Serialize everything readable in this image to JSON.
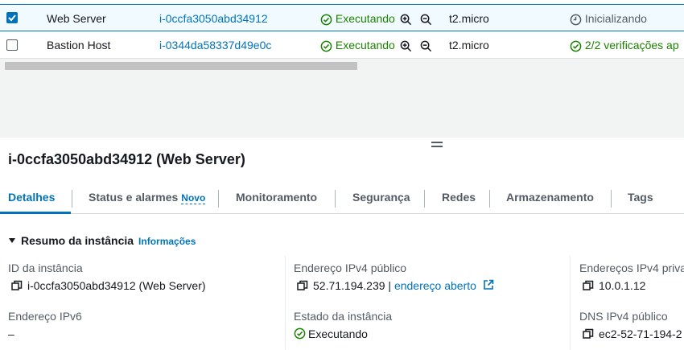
{
  "table": {
    "rows": [
      {
        "selected": true,
        "name": "Web Server",
        "instance_id": "i-0ccfa3050abd34912",
        "state": "Executando",
        "type": "t2.micro",
        "status_check": "Inicializando",
        "status_kind": "pending"
      },
      {
        "selected": false,
        "name": "Bastion Host",
        "instance_id": "i-0344da58337d49e0c",
        "state": "Executando",
        "type": "t2.micro",
        "status_check": "2/2 verificações ap",
        "status_kind": "ok"
      }
    ]
  },
  "details": {
    "title": "i-0ccfa3050abd34912 (Web Server)",
    "tabs": [
      {
        "label": "Detalhes",
        "active": true
      },
      {
        "label": "Status e alarmes",
        "badge": "Novo"
      },
      {
        "label": "Monitoramento"
      },
      {
        "label": "Segurança"
      },
      {
        "label": "Redes"
      },
      {
        "label": "Armazenamento"
      },
      {
        "label": "Tags"
      }
    ],
    "section": {
      "title": "Resumo da instância",
      "info_link": "Informações"
    },
    "fields": {
      "instance_id_label": "ID da instância",
      "instance_id_value": "i-0ccfa3050abd34912 (Web Server)",
      "public_ipv4_label": "Endereço IPv4 público",
      "public_ipv4_value": "52.71.194.239",
      "public_ipv4_sep": " | ",
      "public_ipv4_link": "endereço aberto",
      "private_ipv4_label": "Endereços IPv4 priva",
      "private_ipv4_value": "10.0.1.12",
      "ipv6_label": "Endereço IPv6",
      "ipv6_value": "–",
      "state_label": "Estado da instância",
      "state_value": "Executando",
      "public_dns_label": "DNS IPv4 público",
      "public_dns_value": "ec2-52-71-194-2"
    }
  },
  "colors": {
    "accent": "#0073bb",
    "success": "#1d8102",
    "muted": "#545b64"
  }
}
